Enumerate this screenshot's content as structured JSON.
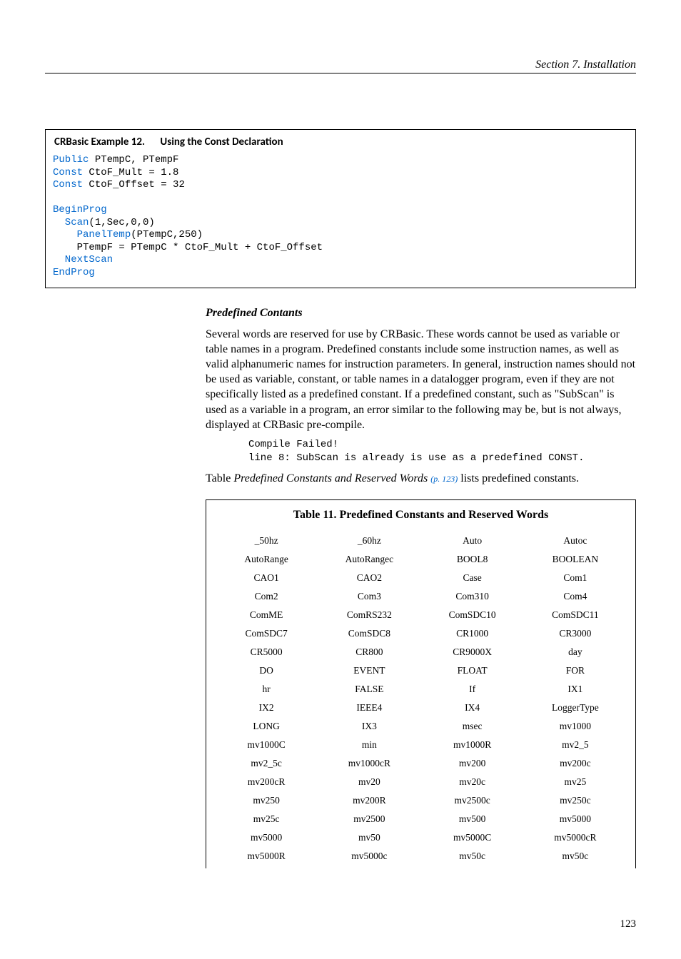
{
  "header": {
    "running": "Section 7.  Installation"
  },
  "example": {
    "label": "CRBasic Example 12.",
    "title": "Using the Const Declaration",
    "code": {
      "l1a": "Public",
      "l1b": " PTempC, PTempF",
      "l2a": "Const",
      "l2b": " CtoF_Mult = 1.8",
      "l3a": "Const",
      "l3b": " CtoF_Offset = 32",
      "l4": " ",
      "l5": "BeginProg",
      "l6a": "  Scan",
      "l6b": "(1,Sec,0,0)",
      "l7a": "    PanelTemp",
      "l7b": "(PTempC,250)",
      "l8": "    PTempF = PTempC * CtoF_Mult + CtoF_Offset",
      "l9": "  NextScan",
      "l10": "EndProg"
    }
  },
  "section": {
    "subhead": "Predefined Contants",
    "para": "Several words are reserved for use by CRBasic. These words cannot be used as variable or table names in a program. Predefined constants include some instruction names, as well as valid alphanumeric names for instruction parameters. In general, instruction names should not be used as variable, constant, or table names in a datalogger program, even if they are not specifically listed as a predefined constant. If a predefined constant, such as \"SubScan\" is used as a variable in a program, an error similar to the following may be, but is not always, displayed at CRBasic pre-compile.",
    "err1": "Compile Failed!",
    "err2": "line 8: SubScan is already is use as a predefined CONST.",
    "ref_a": "Table ",
    "ref_b": "Predefined Constants and Reserved Words ",
    "ref_c": "(p. 123)",
    "ref_d": " lists predefined constants."
  },
  "table11": {
    "caption": "Table 11. Predefined Constants and Reserved Words",
    "rows": [
      [
        "_50hz",
        "_60hz",
        "Auto",
        "Autoc"
      ],
      [
        "AutoRange",
        "AutoRangec",
        "BOOL8",
        "BOOLEAN"
      ],
      [
        "CAO1",
        "CAO2",
        "Case",
        "Com1"
      ],
      [
        "Com2",
        "Com3",
        "Com310",
        "Com4"
      ],
      [
        "ComME",
        "ComRS232",
        "ComSDC10",
        "ComSDC11"
      ],
      [
        "ComSDC7",
        "ComSDC8",
        "CR1000",
        "CR3000"
      ],
      [
        "CR5000",
        "CR800",
        "CR9000X",
        "day"
      ],
      [
        "DO",
        "EVENT",
        "FLOAT",
        "FOR"
      ],
      [
        "hr",
        "FALSE",
        "If",
        "IX1"
      ],
      [
        "IX2",
        "IEEE4",
        "IX4",
        "LoggerType"
      ],
      [
        "LONG",
        "IX3",
        "msec",
        "mv1000"
      ],
      [
        "mv1000C",
        "min",
        "mv1000R",
        "mv2_5"
      ],
      [
        "mv2_5c",
        "mv1000cR",
        "mv200",
        "mv200c"
      ],
      [
        "mv200cR",
        "mv20",
        "mv20c",
        "mv25"
      ],
      [
        "mv250",
        "mv200R",
        "mv2500c",
        "mv250c"
      ],
      [
        "mv25c",
        "mv2500",
        "mv500",
        "mv5000"
      ],
      [
        "mv5000",
        "mv50",
        "mv5000C",
        "mv5000cR"
      ],
      [
        "mv5000R",
        "mv5000c",
        "mv50c",
        "mv50c"
      ]
    ]
  },
  "pagenum": "123"
}
